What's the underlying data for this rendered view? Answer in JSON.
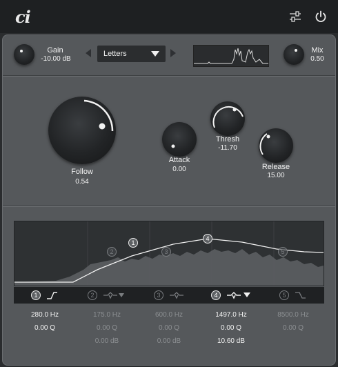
{
  "app": {
    "logo": "ci",
    "settings_icon": "sliders-icon",
    "power_icon": "power-icon"
  },
  "header": {
    "gain": {
      "label": "Gain",
      "value": "-10.00 dB",
      "level": 0.3
    },
    "preset": {
      "selected": "Letters"
    },
    "mix": {
      "label": "Mix",
      "value": "0.50",
      "level": 0.5
    }
  },
  "controls": {
    "follow": {
      "label": "Follow",
      "value": "0.54",
      "level": 0.54
    },
    "attack": {
      "label": "Attack",
      "value": "0.00",
      "level": 0.0
    },
    "thresh": {
      "label": "Thresh",
      "value": "-11.70",
      "level": 0.65
    },
    "release": {
      "label": "Release",
      "value": "15.00",
      "level": 0.15
    }
  },
  "eq": {
    "nodes": [
      {
        "num": "1",
        "active": true
      },
      {
        "num": "2",
        "active": false
      },
      {
        "num": "3",
        "active": false
      },
      {
        "num": "4",
        "active": true
      },
      {
        "num": "5",
        "active": false
      }
    ],
    "bands": [
      {
        "num": "1",
        "active": true,
        "shape": "highpass-icon",
        "freq": "280.0 Hz",
        "q": "0.00 Q",
        "gain": ""
      },
      {
        "num": "2",
        "active": false,
        "shape": "bell-icon",
        "freq": "175.0 Hz",
        "q": "0.00 Q",
        "gain": "0.00 dB"
      },
      {
        "num": "3",
        "active": false,
        "shape": "bell-icon",
        "freq": "600.0 Hz",
        "q": "0.00 Q",
        "gain": "0.00 dB"
      },
      {
        "num": "4",
        "active": true,
        "shape": "bell-icon",
        "freq": "1497.0 Hz",
        "q": "0.00 Q",
        "gain": "10.60 dB"
      },
      {
        "num": "5",
        "active": false,
        "shape": "lowpass-icon",
        "freq": "8500.0 Hz",
        "q": "0.00 Q",
        "gain": ""
      }
    ]
  },
  "colors": {
    "accent": "#ffffff",
    "panel": "#55585b",
    "background": "#2a2c2e"
  }
}
